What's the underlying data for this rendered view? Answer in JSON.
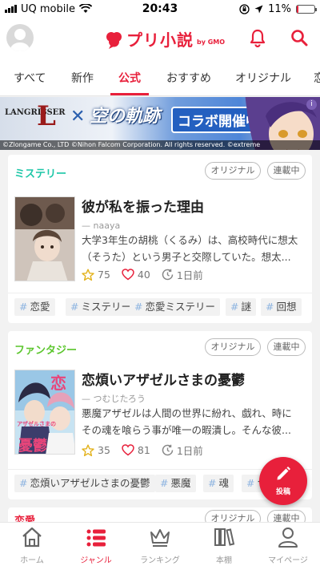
{
  "status_bar": {
    "carrier": "UQ mobile",
    "time": "20:43",
    "battery": "11%",
    "battery_level": 0.11
  },
  "header": {
    "logo_text": "プリ小説",
    "logo_sub": "by GMO"
  },
  "tabs": [
    {
      "label": "すべて"
    },
    {
      "label": "新作"
    },
    {
      "label": "公式",
      "active": true
    },
    {
      "label": "おすすめ"
    },
    {
      "label": "オリジナル"
    },
    {
      "label": "恋"
    }
  ],
  "banner": {
    "logo_text": "LANGRISSER",
    "logo_letter": "L",
    "cross": "✕",
    "partner_title": "空の軌跡",
    "collab_label": "コラボ開催中!",
    "copyright": "©Zlongame Co., LTD  ©Nihon Falcom Corporation. All rights reserved. ©extreme",
    "info": "i"
  },
  "stories": [
    {
      "genre": "ミステリー",
      "genre_color": "#1ec7a8",
      "badges": [
        "オリジナル",
        "連載中"
      ],
      "title": "彼が私を振った理由",
      "author": "— naaya",
      "synopsis_lines": [
        "大学3年生の胡桃（くるみ）は、高校時代に想太",
        "（そうた）という男子と交際していた。想太..."
      ],
      "stars": "75",
      "likes": "40",
      "updated": "1日前",
      "tags": [
        "恋愛",
        "ミステリー",
        "恋愛ミステリー",
        "謎",
        "回想"
      ]
    },
    {
      "genre": "ファンタジー",
      "genre_color": "#5cc62e",
      "badges": [
        "オリジナル",
        "連載中"
      ],
      "title": "恋煩いアザゼルさまの憂鬱",
      "author": "— つむじたろう",
      "synopsis_lines": [
        "悪魔アザゼルは人間の世界に紛れ、戯れ、時に",
        "その魂を喰らう事が唯一の暇潰し。そんな彼..."
      ],
      "stars": "35",
      "likes": "81",
      "updated": "1日前",
      "cover_text_top": "恋",
      "cover_text_mid": "アザゼルさまの",
      "cover_text_bottom": "憂鬱",
      "tags": [
        "恋煩いアザゼルさまの憂鬱",
        "悪魔",
        "魂",
        "つ"
      ]
    },
    {
      "genre": "恋愛",
      "genre_color": "#e8203b",
      "badges": [
        "オリジナル",
        "連載中"
      ]
    }
  ],
  "fab": {
    "label": "投稿"
  },
  "bottom_nav": [
    {
      "label": "ホーム",
      "icon": "home-icon"
    },
    {
      "label": "ジャンル",
      "icon": "list-icon",
      "active": true
    },
    {
      "label": "ランキング",
      "icon": "crown-icon"
    },
    {
      "label": "本棚",
      "icon": "bookshelf-icon"
    },
    {
      "label": "マイページ",
      "icon": "person-icon"
    }
  ],
  "colors": {
    "accent": "#e8203b",
    "tag_hash": "#8cb3e0",
    "background": "#f2f2f2"
  }
}
